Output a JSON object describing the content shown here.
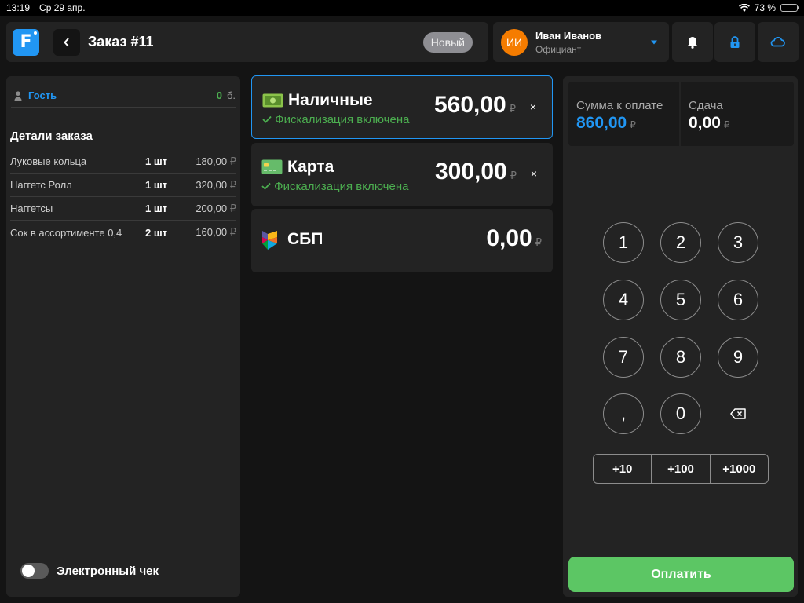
{
  "status_bar": {
    "time": "13:19",
    "date": "Ср 29 апр.",
    "battery_text": "73 %",
    "battery_level": 0.73
  },
  "header": {
    "logo_letter": "F",
    "order_title": "Заказ #11",
    "status_badge": "Новый",
    "user": {
      "initials": "ИИ",
      "name": "Иван Иванов",
      "role": "Официант"
    }
  },
  "left_panel": {
    "guest": {
      "label": "Гость",
      "count": "0",
      "unit": "б."
    },
    "details_title": "Детали заказа",
    "items": [
      {
        "name": "Луковые кольца",
        "qty": "1 шт",
        "price": "180,00"
      },
      {
        "name": "Наггетс Ролл",
        "qty": "1 шт",
        "price": "320,00"
      },
      {
        "name": "Наггетсы",
        "qty": "1 шт",
        "price": "200,00"
      },
      {
        "name": "Сок в ассортименте 0,4",
        "qty": "2 шт",
        "price": "160,00"
      }
    ],
    "echeck_label": "Электронный чек",
    "echeck_enabled": false
  },
  "currency": "₽",
  "payments": {
    "cash": {
      "name": "Наличные",
      "fiscal": "Фискализация включена",
      "amount": "560,00",
      "close": "×"
    },
    "card": {
      "name": "Карта",
      "fiscal": "Фискализация включена",
      "amount": "300,00",
      "close": "×"
    },
    "sbp": {
      "name": "СБП",
      "amount": "0,00"
    }
  },
  "summary": {
    "to_pay_label": "Сумма к оплате",
    "to_pay_value": "860,00",
    "change_label": "Сдача",
    "change_value": "0,00"
  },
  "keypad": {
    "keys": [
      "1",
      "2",
      "3",
      "4",
      "5",
      "6",
      "7",
      "8",
      "9",
      ",",
      "0"
    ],
    "quick": [
      "+10",
      "+100",
      "+1000"
    ]
  },
  "pay_button": "Оплатить",
  "colors": {
    "accent": "#2196f3",
    "success": "#5cc664",
    "fiscal": "#4caf50",
    "avatar": "#f57c00",
    "panel": "#232323",
    "background": "#141414"
  }
}
